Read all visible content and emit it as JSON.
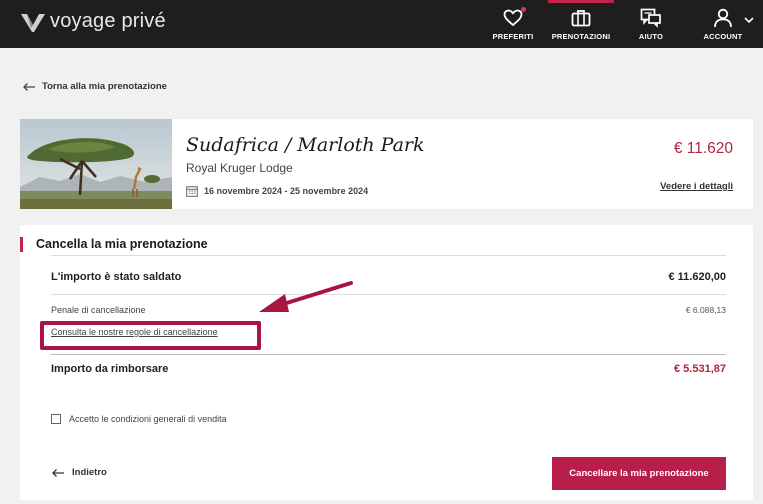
{
  "header": {
    "brand": "voyage privé",
    "nav": [
      {
        "label": "PREFERITI",
        "icon": "heart-icon"
      },
      {
        "label": "PRENOTAZIONI",
        "icon": "suitcase-icon"
      },
      {
        "label": "AIUTO",
        "icon": "chat-icon"
      },
      {
        "label": "ACCOUNT",
        "icon": "user-icon"
      }
    ],
    "active_nav": "PRENOTAZIONI"
  },
  "back_link": "Torna alla mia prenotazione",
  "booking": {
    "title": "Sudafrica / Marloth Park",
    "hotel": "Royal Kruger Lodge",
    "dates": "16 novembre 2024 - 25 novembre 2024",
    "price": "€ 11.620",
    "details_link": "Vedere i dettagli"
  },
  "cancel": {
    "title": "Cancella la mia prenotazione",
    "paid_label": "L'importo è stato saldato",
    "paid_value": "€ 11.620,00",
    "penalty_label": "Penale di cancellazione",
    "penalty_value": "€ 6.088,13",
    "rules_link": "Consulta le nostre regole di cancellazione",
    "refund_label": "Importo da rimborsare",
    "refund_value": "€ 5.531,87",
    "terms_checkbox": "Accetto le condizioni generali di vendita",
    "terms_checked": false,
    "back_label": "Indietro",
    "cancel_button": "Cancellare la mia prenotazione"
  },
  "colors": {
    "accent": "#b81e4a",
    "header_bg": "#1e1e1e",
    "price": "#b0253f",
    "annotation": "#a8163f"
  }
}
